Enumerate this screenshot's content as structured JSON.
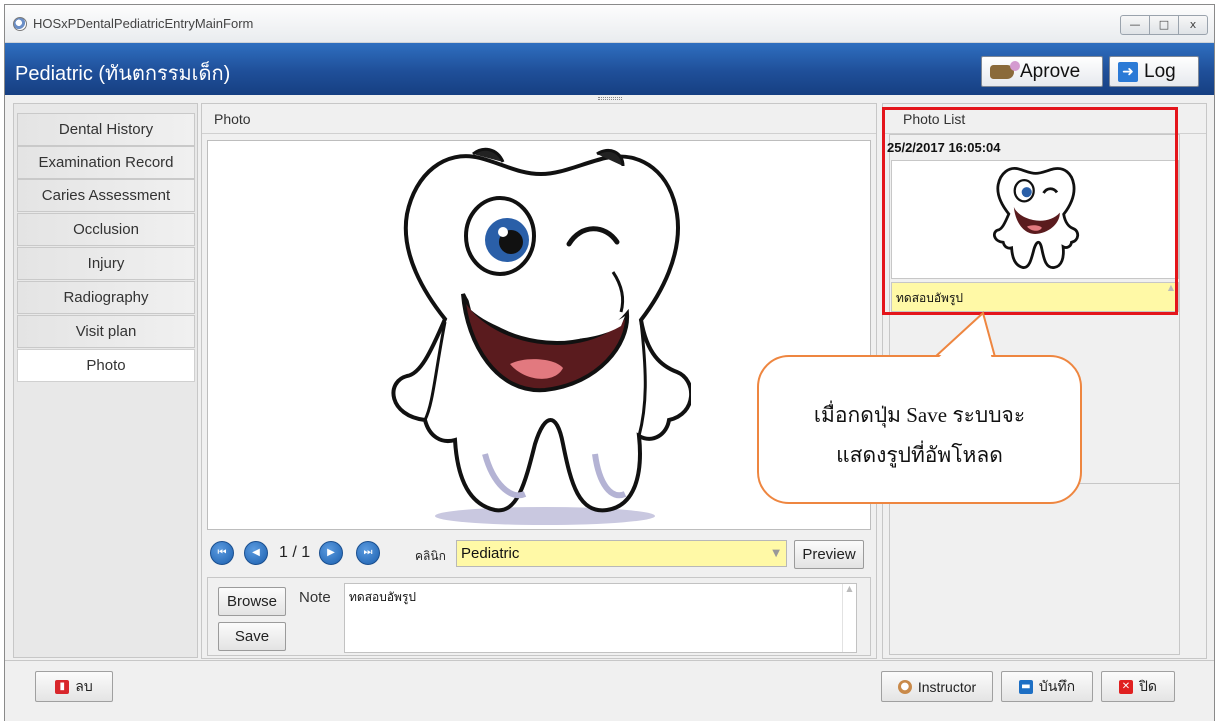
{
  "window": {
    "title": "HOSxPDentalPediatricEntryMainForm",
    "buttons": {
      "minimize": "—",
      "maximize": "□",
      "close": "x"
    }
  },
  "header": {
    "title": "Pediatric (ทันตกรรมเด็ก)",
    "approve_label": "Aprove",
    "log_label": "Log"
  },
  "nav": {
    "tabs": [
      {
        "label": "Dental History"
      },
      {
        "label": "Examination Record"
      },
      {
        "label": "Caries Assessment"
      },
      {
        "label": "Occlusion"
      },
      {
        "label": "Injury"
      },
      {
        "label": "Radiography"
      },
      {
        "label": "Visit plan"
      },
      {
        "label": "Photo"
      }
    ],
    "active_tab": "Photo"
  },
  "photo_panel": {
    "title": "Photo",
    "pager": "1 / 1",
    "clinic_label": "คลินิก",
    "clinic_value": "Pediatric",
    "preview_label": "Preview",
    "browse_label": "Browse",
    "save_label": "Save",
    "note_label": "Note",
    "note_value": "ทดสอบอัพรูป"
  },
  "photo_list": {
    "title": "Photo List",
    "items": [
      {
        "datetime": "25/2/2017 16:05:04",
        "note": "ทดสอบอัพรูป"
      }
    ]
  },
  "callout": {
    "line1": "เมื่อกดปุ่ม Save ระบบจะ",
    "line2": "แสดงรูปที่อัพโหลด"
  },
  "bottom": {
    "delete_label": "ลบ",
    "instructor_label": "Instructor",
    "save_label": "บันทึก",
    "close_label": "ปิด"
  },
  "colors": {
    "header_blue": "#1f4f99",
    "highlight_red": "#e4151b",
    "callout_orange": "#ee8640",
    "field_yellow": "#fff9a6"
  }
}
